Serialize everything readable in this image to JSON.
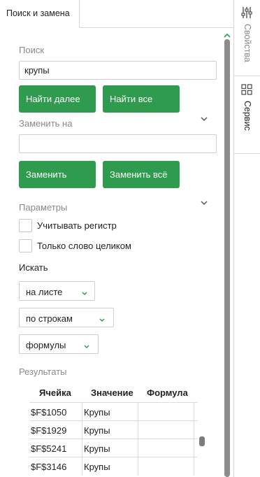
{
  "tab": {
    "title": "Поиск и замена"
  },
  "search": {
    "label": "Поиск",
    "value": "крупы"
  },
  "buttons": {
    "find_next": "Найти далее",
    "find_all": "Найти все",
    "replace": "Заменить",
    "replace_all": "Заменить всё"
  },
  "replace": {
    "label": "Заменить на",
    "value": ""
  },
  "params": {
    "label": "Параметры",
    "match_case": "Учитывать регистр",
    "whole_word": "Только слово целиком",
    "search_in_label": "Искать",
    "scope": "на листе",
    "direction": "по строкам",
    "look_in": "формулы"
  },
  "results": {
    "label": "Результаты",
    "columns": [
      "Ячейка",
      "Значение",
      "Формула"
    ],
    "rows": [
      {
        "cell": "$F$1050",
        "value": "Крупы",
        "formula": ""
      },
      {
        "cell": "$F$1929",
        "value": "Крупы",
        "formula": ""
      },
      {
        "cell": "$F$5241",
        "value": "Крупы",
        "formula": ""
      },
      {
        "cell": "$F$3146",
        "value": "Крупы",
        "formula": ""
      }
    ]
  },
  "sidebar": {
    "properties": "Свойства",
    "service": "Сервис"
  },
  "colors": {
    "accent": "#2e9b4e",
    "muted": "#8a8a8a"
  }
}
